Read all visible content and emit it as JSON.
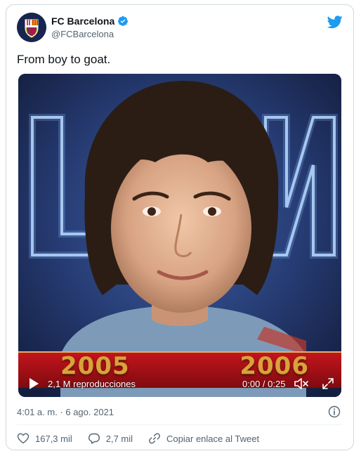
{
  "account": {
    "display_name": "FC Barcelona",
    "handle": "@FCBarcelona"
  },
  "tweet": {
    "text": "From boy to goat.",
    "timestamp": "4:01 a. m. · 6 ago. 2021"
  },
  "video": {
    "year_left": "2005",
    "year_right": "2006",
    "views": "2,1 M reproducciones",
    "time": "0:00 / 0:25"
  },
  "actions": {
    "likes": "167,3 mil",
    "replies": "2,7 mil",
    "copy_link": "Copiar enlace al Tweet"
  },
  "icons": [
    "club-crest-icon",
    "verified-badge-icon",
    "twitter-bird-icon",
    "play-icon",
    "volume-icon",
    "fullscreen-icon",
    "info-icon",
    "heart-icon",
    "reply-icon",
    "link-icon"
  ],
  "colors": {
    "twitter_blue": "#1d9bf0",
    "secondary_text": "#536471",
    "border": "#cfd9de",
    "band_red": "#c4141c",
    "year_gold": "#d9a23a"
  }
}
